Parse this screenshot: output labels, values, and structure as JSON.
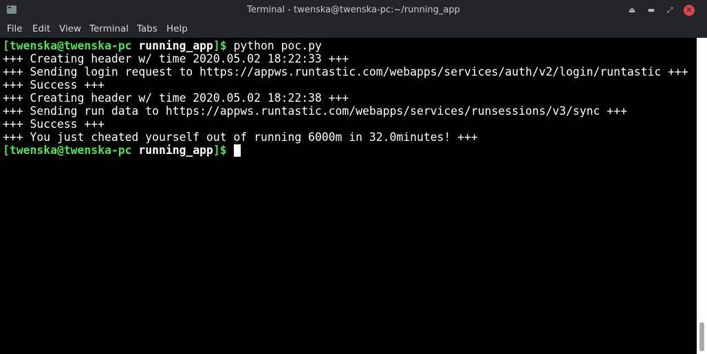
{
  "window": {
    "title": "Terminal - twenska@twenska-pc:~/running_app",
    "icons": [
      "terminal-icon",
      "keep-above-icon",
      "minimize-icon",
      "maximize-icon",
      "close-icon"
    ]
  },
  "menu": [
    "File",
    "Edit",
    "View",
    "Terminal",
    "Tabs",
    "Help"
  ],
  "prompt": {
    "open": "[",
    "user_host": "twenska@twenska-pc",
    "dir": "running_app",
    "close": "]$"
  },
  "command": "python poc.py",
  "output": [
    "+++ Creating header w/ time 2020.05.02 18:22:33 +++",
    "+++ Sending login request to https://appws.runtastic.com/webapps/services/auth/v2/login/runtastic +++",
    "+++ Success +++",
    "+++ Creating header w/ time 2020.05.02 18:22:38 +++",
    "+++ Sending run data to https://appws.runtastic.com/webapps/services/runsessions/v3/sync +++",
    "+++ Success +++",
    "+++ You just cheated yourself out of running 6000m in 32.0minutes! +++"
  ],
  "colors": {
    "prompt_green": "#4ee34e",
    "background": "#000000",
    "chrome": "#232629",
    "close": "#da4453"
  }
}
